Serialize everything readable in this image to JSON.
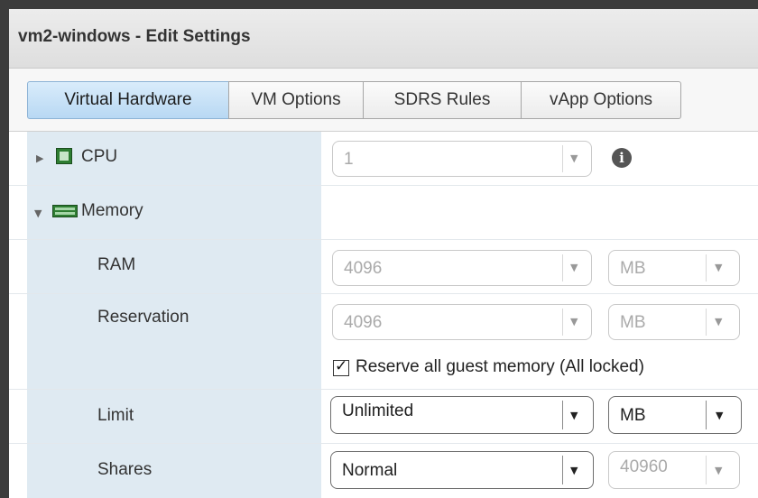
{
  "window": {
    "title": "vm2-windows - Edit Settings"
  },
  "tabs": [
    {
      "label": "Virtual Hardware",
      "active": true
    },
    {
      "label": "VM Options",
      "active": false
    },
    {
      "label": "SDRS Rules",
      "active": false
    },
    {
      "label": "vApp Options",
      "active": false
    }
  ],
  "hardware": {
    "cpu": {
      "label": "CPU",
      "value": "1",
      "expanded": false,
      "icon": "cpu-icon",
      "enabled": false
    },
    "memory": {
      "label": "Memory",
      "expanded": true,
      "icon": "memory-icon",
      "ram": {
        "label": "RAM",
        "value": "4096",
        "unit": "MB",
        "enabled": false
      },
      "reservation": {
        "label": "Reservation",
        "value": "4096",
        "unit": "MB",
        "enabled": false
      },
      "reserve_all": {
        "label": "Reserve all guest memory (All locked)",
        "checked": true
      },
      "limit": {
        "label": "Limit",
        "value": "Unlimited",
        "unit": "MB",
        "enabled": true
      },
      "shares": {
        "label": "Shares",
        "value": "Normal",
        "amount": "40960",
        "enabled": true,
        "amount_enabled": false
      }
    }
  },
  "colors": {
    "tab_active": "#b8d8f3",
    "label_column": "#dfeaf2",
    "title_bar": "#e6e6e6",
    "disabled_text": "#aaaaaa"
  }
}
